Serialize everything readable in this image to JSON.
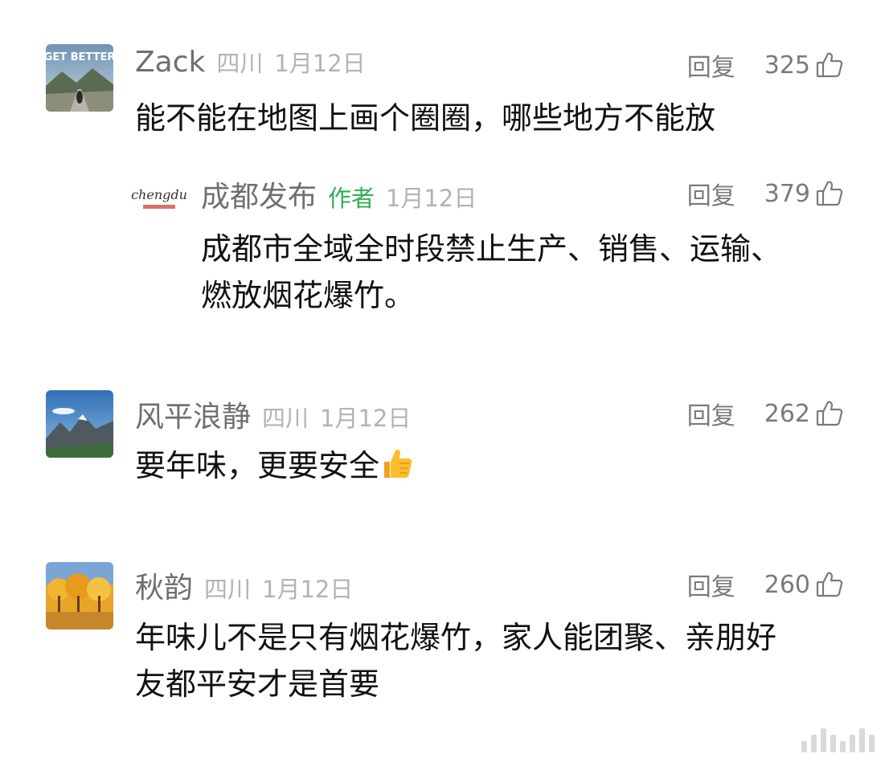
{
  "comments": [
    {
      "username": "Zack",
      "location": "四川",
      "date": "1月12日",
      "reply_label": "回复",
      "likes": "325",
      "text": "能不能在地图上画个圈圈，哪些地方不能放",
      "avatar_text": "GET BETTER",
      "replies": [
        {
          "username": "成都发布",
          "author_tag": "作者",
          "date": "1月12日",
          "reply_label": "回复",
          "likes": "379",
          "text_line1": "成都市全域全时段禁止生产、销售、运输、",
          "text_line2": "燃放烟花爆竹。",
          "avatar_text": "chengdu"
        }
      ]
    },
    {
      "username": "风平浪静",
      "location": "四川",
      "date": "1月12日",
      "reply_label": "回复",
      "likes": "262",
      "text": "要年味，更要安全"
    },
    {
      "username": "秋韵",
      "location": "四川",
      "date": "1月12日",
      "reply_label": "回复",
      "likes": "260",
      "text_line1": "年味儿不是只有烟花爆竹，家人能团聚、亲朋好",
      "text_line2": "友都平安才是首要"
    }
  ],
  "colors": {
    "author_tag": "#2fae55",
    "username": "#6f6f6f",
    "meta": "#b3b3b3"
  },
  "icons": {
    "like": "thumbs-up-outline-icon",
    "emoji": "thumbs-up-emoji-icon"
  }
}
